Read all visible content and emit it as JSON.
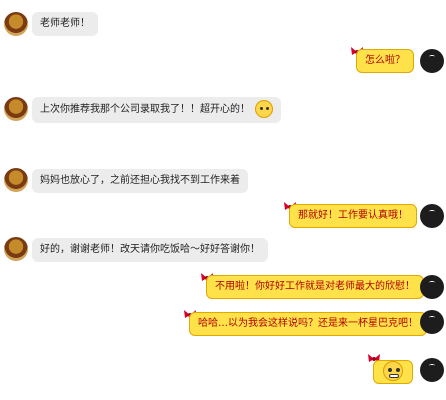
{
  "messages": [
    {
      "side": "left",
      "text": "老师老师！"
    },
    {
      "side": "right",
      "text": "怎么啦？"
    },
    {
      "side": "left",
      "text": "上次你推荐我那个公司录取我了！！超开心的！",
      "emoji": "grin-emoji"
    },
    {
      "side": "left",
      "text": "妈妈也放心了，之前还担心我找不到工作来着"
    },
    {
      "side": "right",
      "text": "那就好！工作要认真哦！"
    },
    {
      "side": "left",
      "text": "好的，谢谢老师！改天请你吃饭哈～好好答谢你！"
    },
    {
      "side": "right",
      "text": "不用啦！你好好工作就是对老师最大的欣慰！"
    },
    {
      "side": "right",
      "text": "哈哈…以为我会这样说吗？还是来一杯星巴克吧！"
    },
    {
      "side": "right",
      "text": "",
      "emoji": "big-emoji"
    }
  ],
  "colors": {
    "left_bubble": "#ececec",
    "right_bubble": "#ffe24a",
    "right_text": "#b00000"
  }
}
